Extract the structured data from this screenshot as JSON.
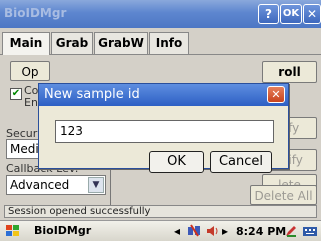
{
  "window": {
    "title": "BioIDMgr",
    "help_label": "?",
    "ok_label": "OK",
    "close_label": "✕"
  },
  "tabs": [
    {
      "label": "Main"
    },
    {
      "label": "Grab"
    },
    {
      "label": "GrabW"
    },
    {
      "label": "Info"
    }
  ],
  "main": {
    "open_label": "Op",
    "enroll_label": "roll",
    "checkbox_label_1": "Co",
    "checkbox_label_2": "En",
    "verify_label": "rify",
    "identify_label": "ntify",
    "delete_label": "lete",
    "delete_all_label": "Delete All",
    "security_label": "Securi",
    "security_value": "Mediu",
    "callback_label": "Callback Lev:",
    "callback_value": "Advanced"
  },
  "status": {
    "text": "Session opened successfully"
  },
  "dialog": {
    "title": "New sample id",
    "input_value": "123",
    "ok_label": "OK",
    "cancel_label": "Cancel"
  },
  "taskbar": {
    "app_label": "BioIDMgr",
    "clock": "8:24 PM"
  },
  "icons": {
    "start": "windows-flag-icon",
    "tray_arrow": "tray-arrow-icon",
    "network": "network-icon",
    "pen": "pen-icon",
    "keyboard": "keyboard-icon"
  }
}
